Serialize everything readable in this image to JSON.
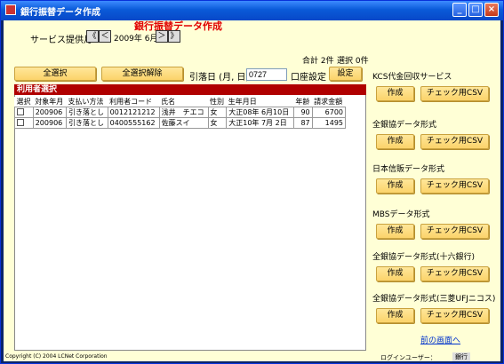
{
  "window": {
    "title": "銀行振替データ作成"
  },
  "header": {
    "heading": "銀行振替データ作成"
  },
  "service": {
    "label": "サービス提供月",
    "prev_prev": "《",
    "prev": "＜",
    "month": "2009年 6月",
    "next": "＞",
    "next_next": "》"
  },
  "summary": {
    "total": "合計 2件",
    "selected": "選択 0件"
  },
  "toolbar": {
    "select_all": "全選択",
    "deselect_all": "全選択解除",
    "date_label": "引落日 (月, 日)",
    "date_value": "0727",
    "account_label": "口座設定",
    "settings": "設定"
  },
  "list": {
    "title": "利用者選択",
    "columns": [
      "選択",
      "対象年月",
      "支払い方法",
      "利用者コード",
      "氏名",
      "性別",
      "生年月日",
      "年齢",
      "請求金額"
    ],
    "rows": [
      [
        "",
        "200906",
        "引き落とし",
        "0012121212",
        "浅井　チエコ",
        "女",
        "大正08年 6月10日",
        "90",
        "6700"
      ],
      [
        "",
        "200906",
        "引き落とし",
        "0400555162",
        "佐藤スイ",
        "女",
        "大正10年 7月 2日",
        "87",
        "1495"
      ]
    ]
  },
  "sections": [
    {
      "label": "KCS代金回収サービス",
      "create": "作成",
      "check": "チェック用CSV"
    },
    {
      "label": "全銀協データ形式",
      "create": "作成",
      "check": "チェック用CSV"
    },
    {
      "label": "日本信販データ形式",
      "create": "作成",
      "check": "チェック用CSV"
    },
    {
      "label": "MBSデータ形式",
      "create": "作成",
      "check": "チェック用CSV"
    },
    {
      "label": "全銀協データ形式(十六銀行)",
      "create": "作成",
      "check": "チェック用CSV"
    },
    {
      "label": "全銀協データ形式(三菱UFJニコス)",
      "create": "作成",
      "check": "チェック用CSV"
    }
  ],
  "footer": {
    "back_link": "前の画面へ",
    "copyright": "Copyright (C) 2004 LCNet Corporation",
    "login_label": "ログインユーザー：",
    "login_user": "銀行"
  },
  "colors": {
    "background": "#ffffd6",
    "heading": "#e00000",
    "list_header": "#b00000",
    "button": "#fbd36a",
    "link": "#0033cc"
  },
  "icons": {
    "app": "app-icon",
    "minimize": "minimize-icon",
    "maximize": "maximize-icon",
    "close": "close-icon"
  }
}
